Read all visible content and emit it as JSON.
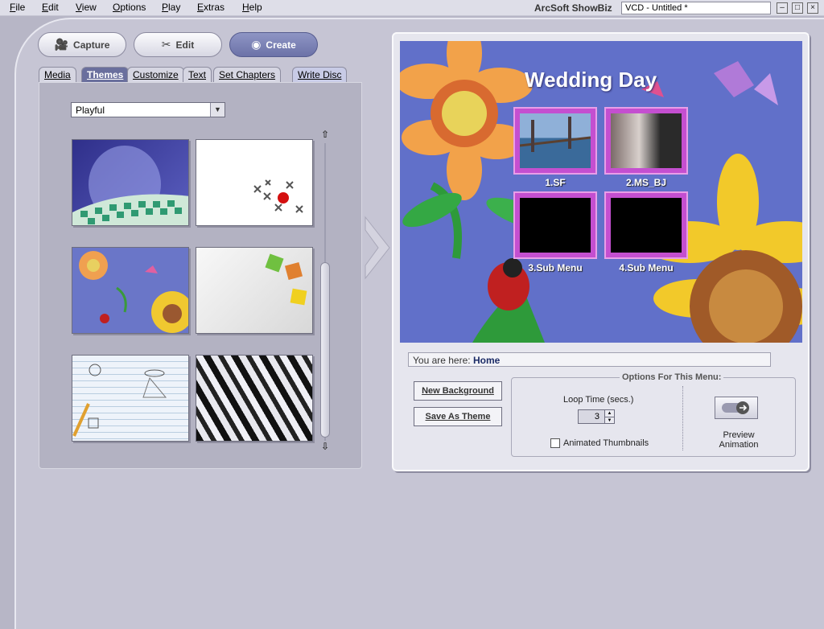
{
  "menubar": {
    "items": [
      "File",
      "Edit",
      "View",
      "Options",
      "Play",
      "Extras",
      "Help"
    ],
    "app_title": "ArcSoft ShowBiz",
    "doc_title": "VCD - Untitled *"
  },
  "modes": {
    "capture": "Capture",
    "edit": "Edit",
    "create": "Create"
  },
  "tabs": {
    "media": "Media",
    "themes": "Themes",
    "customize": "Customize",
    "text": "Text",
    "set_chapters": "Set Chapters",
    "write_disc": "Write Disc"
  },
  "theme_category": "Playful",
  "themes": [
    {
      "icon": "spotlight-checkered-theme"
    },
    {
      "icon": "jacks-ball-theme"
    },
    {
      "icon": "flowers-theme"
    },
    {
      "icon": "puzzle-pieces-theme"
    },
    {
      "icon": "doodle-notebook-theme"
    },
    {
      "icon": "zebra-stripes-theme"
    }
  ],
  "preview": {
    "menu_title": "Wedding Day",
    "thumbnails": [
      {
        "label": "1.SF"
      },
      {
        "label": "2.MS_BJ"
      },
      {
        "label": "3.Sub Menu"
      },
      {
        "label": "4.Sub Menu"
      }
    ]
  },
  "breadcrumb": {
    "prefix": "You are here:",
    "location": "Home"
  },
  "buttons": {
    "new_background": "New Background",
    "save_as_theme": "Save As Theme"
  },
  "options": {
    "title": "Options For This Menu:",
    "loop_label": "Loop Time (secs.)",
    "loop_value": "3",
    "animated_label": "Animated Thumbnails",
    "animated_checked": false,
    "preview_label_1": "Preview",
    "preview_label_2": "Animation"
  }
}
